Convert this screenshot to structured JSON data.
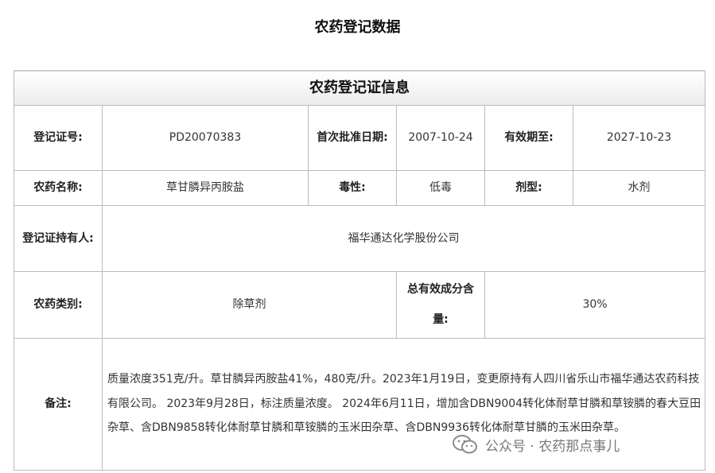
{
  "page": {
    "title": "农药登记数据"
  },
  "table": {
    "header": "农药登记证信息",
    "row1": {
      "reg_no_label": "登记证号:",
      "reg_no": "PD20070383",
      "first_approval_label": "首次批准日期:",
      "first_approval": "2007-10-24",
      "valid_until_label": "有效期至:",
      "valid_until": "2027-10-23"
    },
    "row2": {
      "name_label": "农药名称:",
      "name": "草甘膦异丙胺盐",
      "toxicity_label": "毒性:",
      "toxicity": "低毒",
      "formulation_label": "剂型:",
      "formulation": "水剂"
    },
    "row3": {
      "holder_label": "登记证持有人:",
      "holder": "福华通达化学股份公司"
    },
    "row4": {
      "category_label": "农药类别:",
      "category": "除草剂",
      "content_label": "总有效成分含量:",
      "content": "30%"
    },
    "row5": {
      "remark_label": "备注:",
      "remark": "质量浓度351克/升。草甘膦异丙胺盐41%，480克/升。2023年1月19日，变更原持有人四川省乐山市福华通达农药科技有限公司。 2023年9月28日，标注质量浓度。 2024年6月11日，增加含DBN9004转化体耐草甘膦和草铵膦的春大豆田杂草、含DBN9858转化体耐草甘膦和草铵膦的玉米田杂草、含DBN9936转化体耐草甘膦的玉米田杂草。"
    }
  },
  "watermark": {
    "text": "公众号 · 农药那点事儿",
    "icon": "wechat-icon"
  }
}
